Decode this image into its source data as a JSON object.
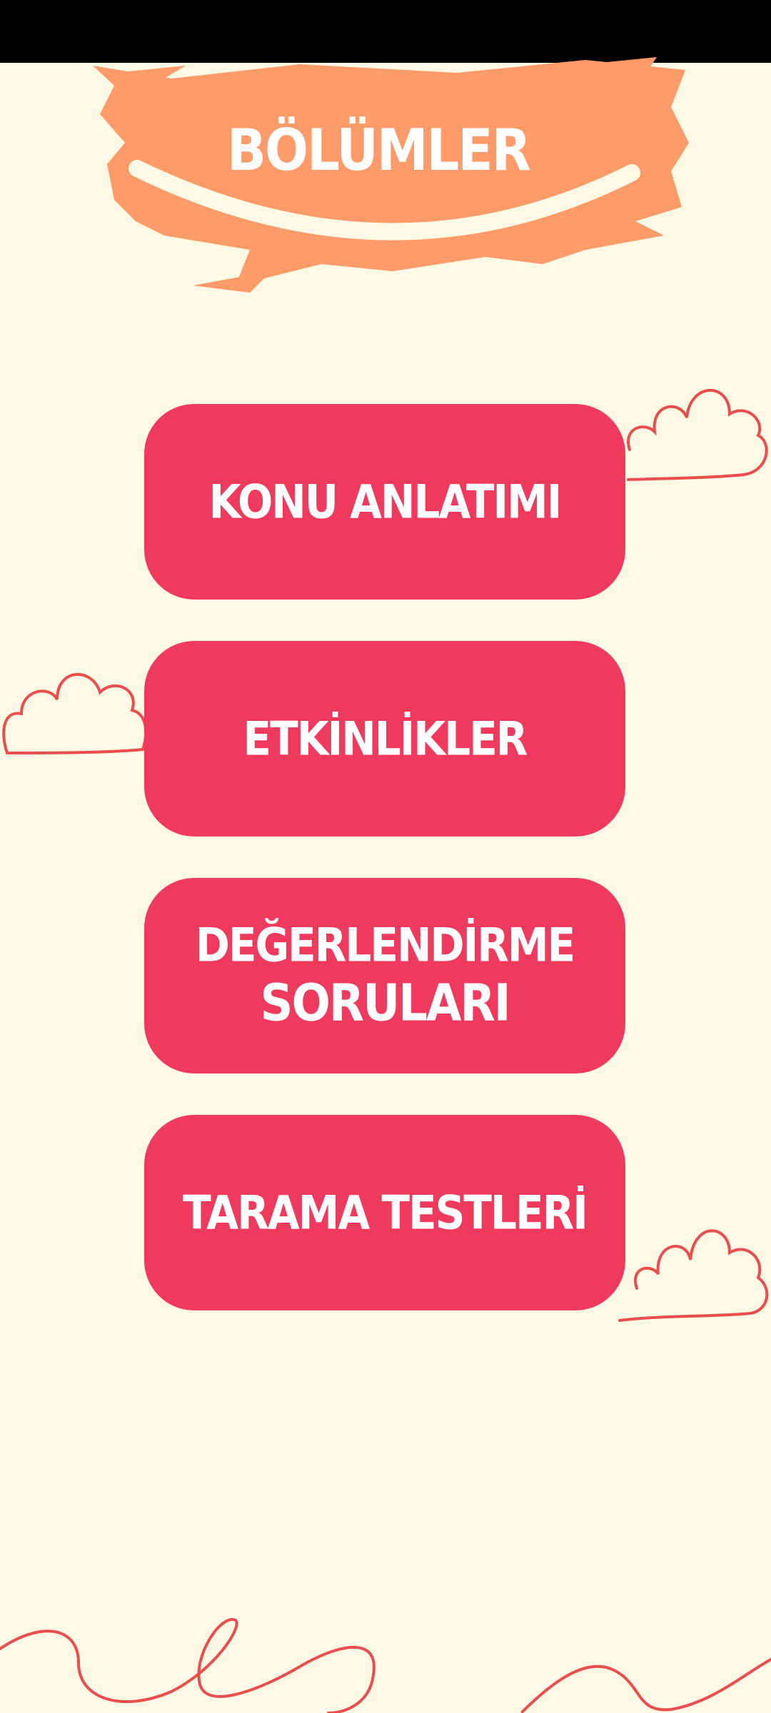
{
  "header": {
    "title": "BÖLÜMLER",
    "splash_color": "#FF9B69"
  },
  "menu": [
    {
      "label": "KONU ANLATIMI"
    },
    {
      "label": "ETKİNLİKLER"
    },
    {
      "label_line1": "DEĞERLENDİRME",
      "label_line2": "SORULARI"
    },
    {
      "label": "TARAMA TESTLERİ"
    }
  ],
  "colors": {
    "background": "#FEF9E5",
    "button": "#EF3A5D",
    "button_text": "#FFFFFF",
    "doodle_stroke": "#EA4D4D",
    "status_bar": "#000000"
  },
  "decorations": [
    "cloud-doodle",
    "cloud-doodle",
    "cloud-doodle",
    "squiggle-doodle",
    "squiggle-doodle"
  ]
}
